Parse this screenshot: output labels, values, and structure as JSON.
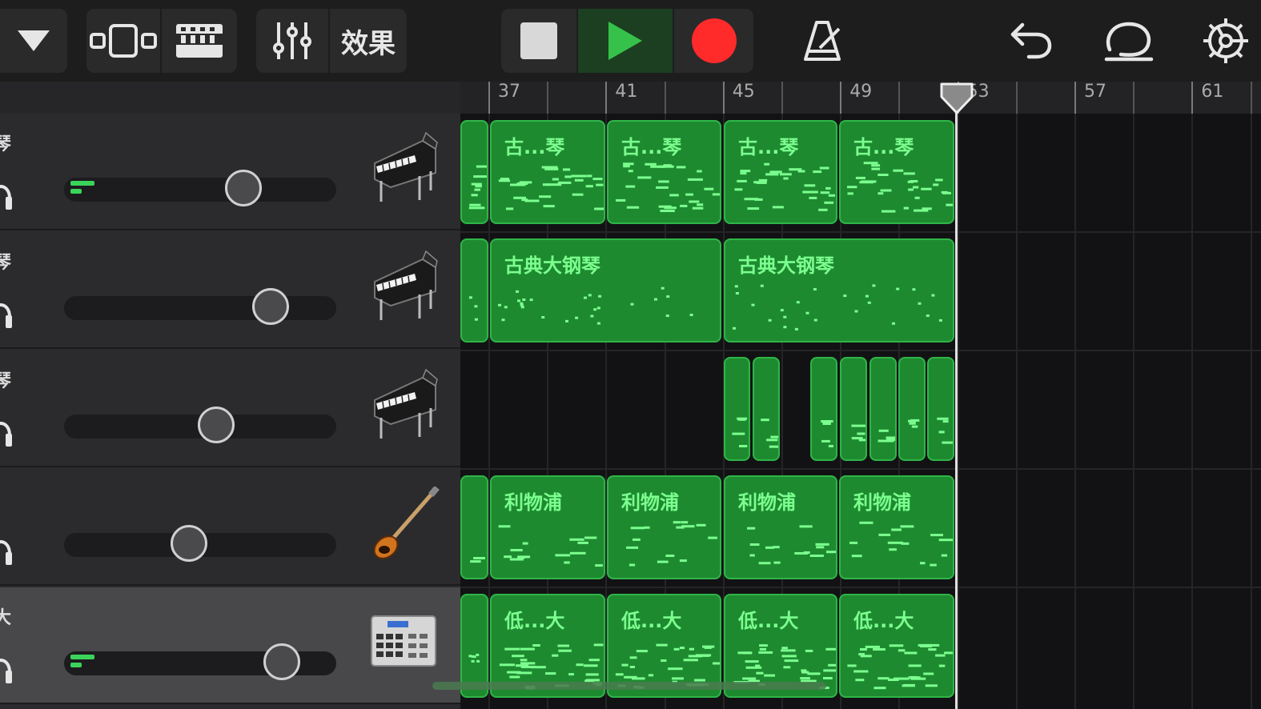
{
  "toolbar": {
    "effects_label": "效果",
    "icons": [
      "track-menu-icon",
      "tracks-view-icon",
      "browser-icon",
      "mixer-icon",
      "stop-icon",
      "play-icon",
      "record-icon",
      "metronome-icon",
      "undo-icon",
      "loop-icon",
      "settings-icon"
    ],
    "colors": {
      "play_bg": "#1c3f22",
      "play": "#36c24a",
      "record": "#ff2a2a"
    }
  },
  "ruler": {
    "bars": [
      "37",
      "41",
      "45",
      "49",
      "53",
      "57",
      "61"
    ]
  },
  "tracks": [
    {
      "name": "琴",
      "instrument": "grand-piano",
      "volume": 0.66,
      "meter_active": true
    },
    {
      "name": "琴",
      "instrument": "grand-piano",
      "volume": 0.76,
      "meter_active": false
    },
    {
      "name": "琴",
      "instrument": "grand-piano",
      "volume": 0.56,
      "meter_active": false
    },
    {
      "name": "",
      "instrument": "bass-guitar",
      "volume": 0.46,
      "meter_active": false
    },
    {
      "name": "大",
      "instrument": "drum-machine",
      "volume": 0.8,
      "meter_active": true,
      "selected": true
    }
  ],
  "regions": {
    "track1": [
      "古...琴",
      "古...琴",
      "古...琴",
      "古...琴"
    ],
    "track2": [
      "古典大钢琴",
      "古典大钢琴"
    ],
    "track4": [
      "利物浦",
      "利物浦",
      "利物浦",
      "利物浦"
    ],
    "track5": [
      "低...大",
      "低...大",
      "低...大",
      "低...大"
    ]
  }
}
